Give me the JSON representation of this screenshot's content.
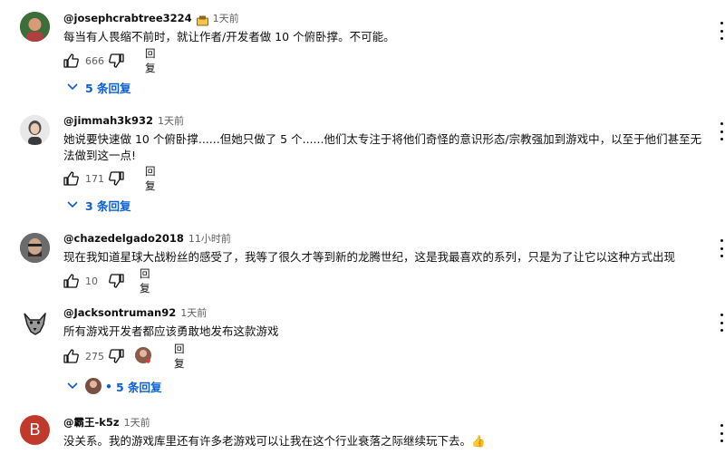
{
  "comments": [
    {
      "username": "@josephcrabtree3224",
      "time": "1天前",
      "text": "每当有人畏缩不前时，就让作者/开发者做 10 个俯卧撑。不可能。",
      "likes": "666",
      "reply_label": "回复",
      "replies": "5 条回复"
    },
    {
      "username": "@jimmah3k932",
      "time": "1天前",
      "text": "她说要快速做 10 个俯卧撑......但她只做了 5 个......他们太专注于将他们奇怪的意识形态/宗教强加到游戏中，以至于他们甚至无法做到这一点!",
      "likes": "171",
      "reply_label": "回复",
      "replies": "3 条回复"
    },
    {
      "username": "@chazedelgado2018",
      "time": "11小时前",
      "text": "现在我知道星球大战粉丝的感受了，我等了很久才等到新的龙腾世纪，这是我最喜欢的系列，只是为了让它以这种方式出现",
      "likes": "10",
      "reply_label": "回复"
    },
    {
      "username": "@Jacksontruman92",
      "time": "1天前",
      "text": "所有游戏开发者都应该勇敢地发布这款游戏",
      "likes": "275",
      "reply_label": "回复",
      "replies_prefix": "•",
      "replies": "5 条回复"
    },
    {
      "username": "@霸王-k5z",
      "time": "1天前",
      "avatar_letter": "B",
      "text": "没关系。我的游戏库里还有许多老游戏可以让我在这个行业衰落之际继续玩下去。👍"
    }
  ],
  "colors": {
    "link": "#065fd4",
    "secondary_text": "#606060",
    "avatar_b": "#c0392b"
  }
}
